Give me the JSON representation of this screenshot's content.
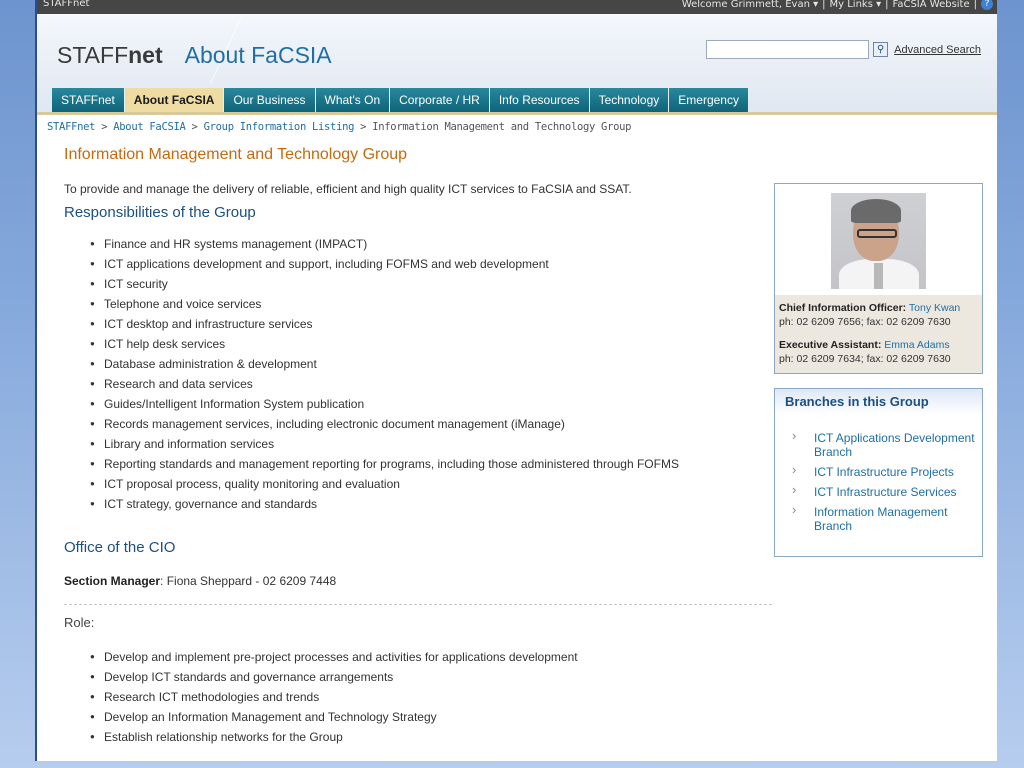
{
  "topbar": {
    "site": "STAFFnet",
    "welcome": "Welcome Grimmett, Evan",
    "my_links": "My Links",
    "facsia_website": "FaCSIA Website",
    "separator": "|",
    "help_icon": "?"
  },
  "header": {
    "logo_main": "STAFF",
    "logo_bold": "net",
    "logo_sub": "About FaCSIA",
    "search_placeholder": "",
    "search_icon": "magnifier-icon",
    "advanced_search": "Advanced Search"
  },
  "nav": {
    "tabs": [
      {
        "label": "STAFFnet",
        "active": false
      },
      {
        "label": "About FaCSIA",
        "active": true
      },
      {
        "label": "Our Business",
        "active": false
      },
      {
        "label": "What's On",
        "active": false
      },
      {
        "label": "Corporate / HR",
        "active": false
      },
      {
        "label": "Info Resources",
        "active": false
      },
      {
        "label": "Technology",
        "active": false
      },
      {
        "label": "Emergency",
        "active": false
      }
    ]
  },
  "breadcrumb": {
    "items": [
      "STAFFnet",
      "About FaCSIA",
      "Group Information Listing"
    ],
    "current": "Information Management and Technology Group",
    "sep": " > "
  },
  "main": {
    "title": "Information Management and Technology Group",
    "intro": "To provide and manage the delivery of reliable, efficient and high quality ICT services to FaCSIA and SSAT.",
    "responsibilities_heading": "Responsibilities of the Group",
    "responsibilities": [
      "Finance and HR systems management (IMPACT)",
      "ICT applications development and support, including FOFMS and web development",
      "ICT security",
      "Telephone and voice services",
      "ICT desktop and infrastructure services",
      "ICT help desk services",
      "Database administration & development",
      "Research and data services",
      "Guides/Intelligent Information System publication",
      "Records management services, including electronic document management (iManage)",
      "Library and information services",
      "Reporting standards and management reporting for programs, including those administered through FOFMS",
      "ICT proposal process, quality monitoring and evaluation",
      "ICT strategy, governance and standards"
    ],
    "cio_heading": "Office of the CIO",
    "section_manager_label": "Section Manager",
    "section_manager_value": ": Fiona Sheppard - 02 6209 7448",
    "role_heading": "Role:",
    "roles": [
      "Develop and implement pre-project processes and activities for applications development",
      "Develop ICT standards and governance arrangements",
      "Research ICT methodologies and trends",
      "Develop an Information Management and Technology Strategy",
      "Establish relationship networks for the Group"
    ]
  },
  "sidebar": {
    "cio_label": "Chief Information Officer:",
    "cio_name": "Tony Kwan",
    "cio_phone": "ph: 02 6209 7656;  fax: 02 6209 7630",
    "ea_label": "Executive Assistant:",
    "ea_name": "Emma Adams",
    "ea_phone": "ph: 02 6209 7634; fax: 02 6209 7630",
    "branches_heading": "Branches in this Group",
    "branches": [
      "ICT Applications Development Branch",
      "ICT Infrastructure Projects",
      "ICT Infrastructure Services",
      "Information Management Branch"
    ]
  },
  "colors": {
    "accent_title": "#c66a0c",
    "heading_blue": "#1c4f82",
    "link_blue": "#1f6fa6",
    "nav_teal": "#0e6278",
    "nav_active": "#efdca3"
  }
}
